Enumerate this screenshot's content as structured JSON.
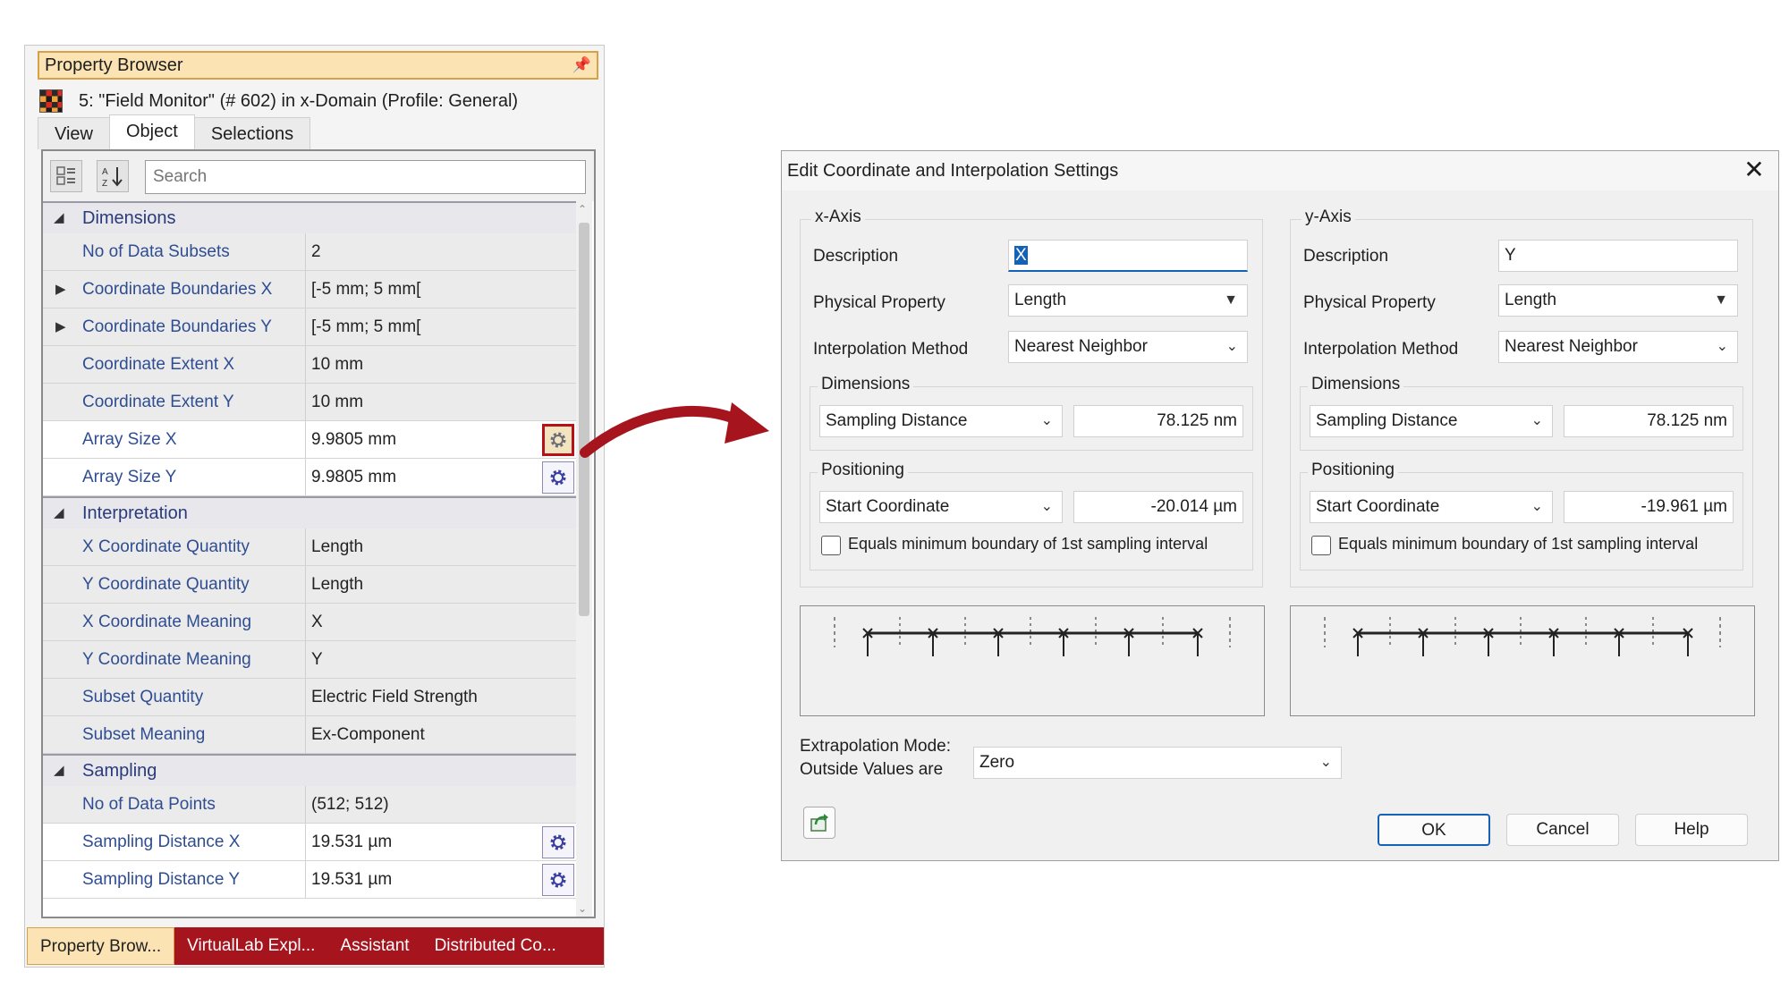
{
  "property_browser": {
    "title": "Property Browser",
    "object_label": "5: \"Field Monitor\" (# 602) in x-Domain (Profile: General)",
    "tabs": [
      "View",
      "Object",
      "Selections"
    ],
    "active_tab": "Object",
    "search_placeholder": "Search",
    "categories": [
      {
        "name": "Dimensions",
        "rows": [
          {
            "name": "No of Data Subsets",
            "value": "2"
          },
          {
            "name": "Coordinate Boundaries X",
            "value": "[-5 mm; 5 mm[",
            "expandable": true
          },
          {
            "name": "Coordinate Boundaries Y",
            "value": "[-5 mm; 5 mm[",
            "expandable": true
          },
          {
            "name": "Coordinate Extent X",
            "value": "10 mm"
          },
          {
            "name": "Coordinate Extent Y",
            "value": "10 mm"
          },
          {
            "name": "Array Size X",
            "value": "9.9805 mm",
            "editable": true,
            "gear": "active"
          },
          {
            "name": "Array Size Y",
            "value": "9.9805 mm",
            "editable": true,
            "gear": "normal"
          }
        ]
      },
      {
        "name": "Interpretation",
        "rows": [
          {
            "name": "X Coordinate Quantity",
            "value": "Length"
          },
          {
            "name": "Y Coordinate Quantity",
            "value": "Length"
          },
          {
            "name": "X Coordinate Meaning",
            "value": "X"
          },
          {
            "name": "Y Coordinate Meaning",
            "value": "Y"
          },
          {
            "name": "Subset Quantity",
            "value": "Electric Field Strength"
          },
          {
            "name": "Subset Meaning",
            "value": "Ex-Component"
          }
        ]
      },
      {
        "name": "Sampling",
        "rows": [
          {
            "name": "No of Data Points",
            "value": "(512; 512)"
          },
          {
            "name": "Sampling Distance X",
            "value": "19.531 µm",
            "editable": true,
            "gear": "normal"
          },
          {
            "name": "Sampling Distance Y",
            "value": "19.531 µm",
            "editable": true,
            "gear": "normal"
          }
        ]
      }
    ],
    "bottom_tabs": [
      "Property Brow...",
      "VirtualLab Expl...",
      "Assistant",
      "Distributed Co..."
    ]
  },
  "dialog": {
    "title": "Edit Coordinate and Interpolation Settings",
    "axes": [
      {
        "legend": "x-Axis",
        "description_label": "Description",
        "description_value": "X",
        "physical_property_label": "Physical Property",
        "physical_property_value": "Length",
        "interpolation_label": "Interpolation Method",
        "interpolation_value": "Nearest Neighbor",
        "dimensions_title": "Dimensions",
        "dimensions_mode": "Sampling Distance",
        "dimensions_value": "78.125 nm",
        "positioning_title": "Positioning",
        "positioning_mode": "Start Coordinate",
        "positioning_value": "-20.014 µm",
        "checkbox_label": "Equals minimum boundary of 1st sampling interval",
        "checkbox_checked": false
      },
      {
        "legend": "y-Axis",
        "description_label": "Description",
        "description_value": "Y",
        "physical_property_label": "Physical Property",
        "physical_property_value": "Length",
        "interpolation_label": "Interpolation Method",
        "interpolation_value": "Nearest Neighbor",
        "dimensions_title": "Dimensions",
        "dimensions_mode": "Sampling Distance",
        "dimensions_value": "78.125 nm",
        "positioning_title": "Positioning",
        "positioning_mode": "Start Coordinate",
        "positioning_value": "-19.961 µm",
        "checkbox_label": "Equals minimum boundary of 1st sampling interval",
        "checkbox_checked": false
      }
    ],
    "extrapolation_label_1": "Extrapolation Mode:",
    "extrapolation_label_2": "Outside Values are",
    "extrapolation_value": "Zero",
    "buttons": {
      "ok": "OK",
      "cancel": "Cancel",
      "help": "Help"
    }
  },
  "colors": {
    "accent_red": "#a6151e",
    "title_highlight": "#fbe3b3",
    "focus_blue": "#1462b8"
  }
}
